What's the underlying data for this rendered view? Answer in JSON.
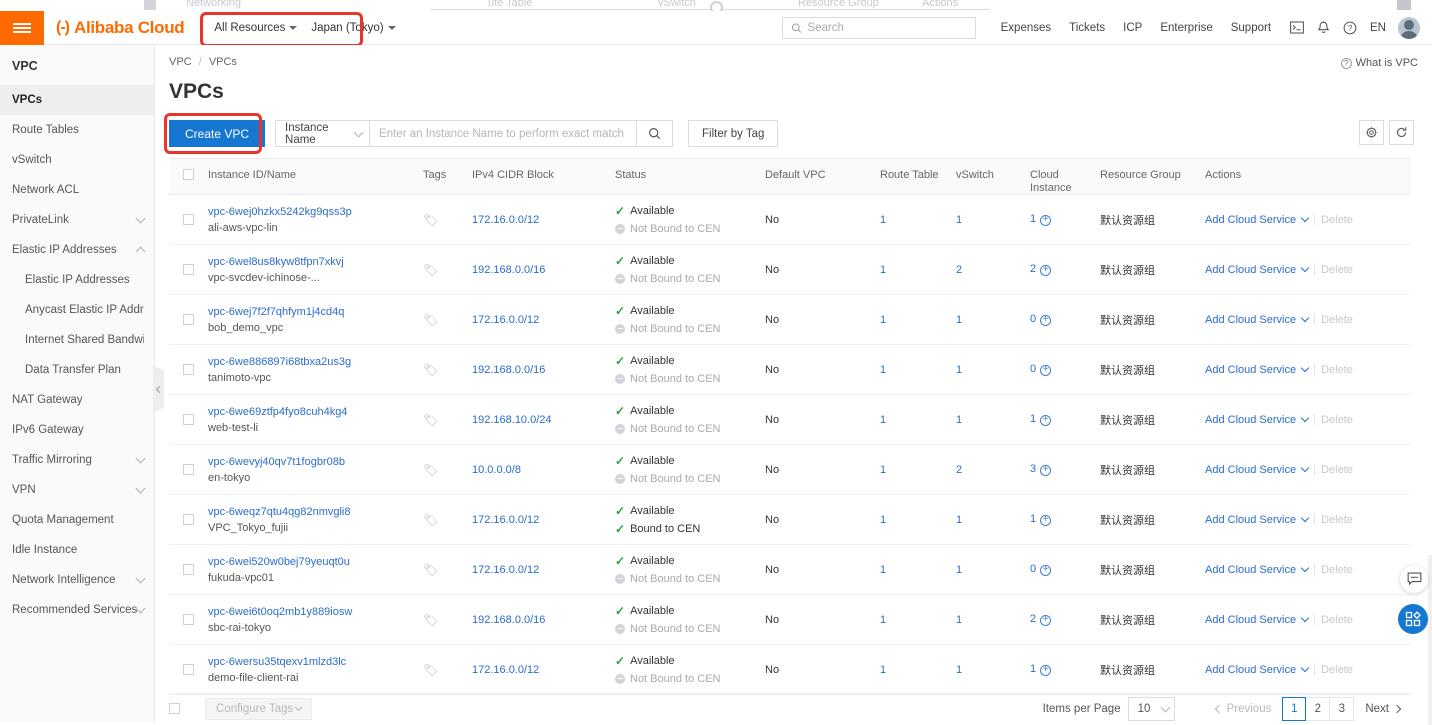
{
  "header": {
    "logo": "Alibaba Cloud",
    "logo_mark": "(-)",
    "resources_label": "All Resources",
    "region_label": "Japan (Tokyo)",
    "search_placeholder": "Search",
    "search_value": "",
    "links": [
      "Expenses",
      "Tickets",
      "ICP",
      "Enterprise",
      "Support"
    ],
    "icons": [
      "console-icon",
      "bell-icon",
      "help-icon"
    ],
    "language": "EN",
    "avatar": "user-avatar"
  },
  "sidebar": {
    "title": "VPC",
    "items": [
      {
        "label": "VPCs",
        "active": true,
        "expandable": false,
        "sub": false
      },
      {
        "label": "Route Tables",
        "active": false,
        "expandable": false,
        "sub": false
      },
      {
        "label": "vSwitch",
        "active": false,
        "expandable": false,
        "sub": false
      },
      {
        "label": "Network ACL",
        "active": false,
        "expandable": false,
        "sub": false
      },
      {
        "label": "PrivateLink",
        "active": false,
        "expandable": true,
        "expanded": false,
        "sub": false
      },
      {
        "label": "Elastic IP Addresses",
        "active": false,
        "expandable": true,
        "expanded": true,
        "sub": false
      },
      {
        "label": "Elastic IP Addresses",
        "active": false,
        "expandable": false,
        "sub": true
      },
      {
        "label": "Anycast Elastic IP Addresses",
        "active": false,
        "expandable": false,
        "sub": true
      },
      {
        "label": "Internet Shared Bandwidth",
        "active": false,
        "expandable": false,
        "sub": true
      },
      {
        "label": "Data Transfer Plan",
        "active": false,
        "expandable": false,
        "sub": true
      },
      {
        "label": "NAT Gateway",
        "active": false,
        "expandable": false,
        "sub": false
      },
      {
        "label": "IPv6 Gateway",
        "active": false,
        "expandable": false,
        "sub": false
      },
      {
        "label": "Traffic Mirroring",
        "active": false,
        "expandable": true,
        "expanded": false,
        "sub": false
      },
      {
        "label": "VPN",
        "active": false,
        "expandable": true,
        "expanded": false,
        "sub": false
      },
      {
        "label": "Quota Management",
        "active": false,
        "expandable": false,
        "sub": false
      },
      {
        "label": "Idle Instance",
        "active": false,
        "expandable": false,
        "sub": false
      },
      {
        "label": "Network Intelligence",
        "active": false,
        "expandable": true,
        "expanded": false,
        "sub": false
      },
      {
        "label": "Recommended Services",
        "active": false,
        "expandable": true,
        "expanded": false,
        "sub": false
      }
    ]
  },
  "main": {
    "breadcrumb": [
      "VPC",
      "VPCs"
    ],
    "breadcrumb_separator": "/",
    "what_is_link": "What is VPC",
    "page_title": "VPCs",
    "toolbar": {
      "create_button": "Create VPC",
      "filter_select": "Instance Name",
      "search_placeholder": "Enter an Instance Name to perform exact match",
      "search_value": "",
      "filter_by_tag": "Filter by Tag",
      "settings_icon": "gear-icon",
      "refresh_icon": "refresh-icon"
    },
    "table": {
      "columns": [
        "Instance ID/Name",
        "Tags",
        "IPv4 CIDR Block",
        "Status",
        "Default VPC",
        "Route Table",
        "vSwitch",
        "Cloud Instance",
        "Resource Group",
        "Actions"
      ],
      "cloud_instance_header_line1": "Cloud",
      "cloud_instance_header_line2": "Instance",
      "rows": [
        {
          "id": "vpc-6wej0hzkx5242kg9qss3p",
          "name": "ali-aws-vpc-lin",
          "cidr": "172.16.0.0/12",
          "status": "Available",
          "cen": "Not Bound to CEN",
          "cen_bound": false,
          "default_vpc": "No",
          "route_table": "1",
          "vswitch": "1",
          "cloud_instance": "1",
          "resource_group": "默认资源组",
          "action_primary": "Add Cloud Service",
          "action_secondary": "Delete"
        },
        {
          "id": "vpc-6wel8us8kyw8tfpn7xkvj",
          "name": "vpc-svcdev-ichinose-...",
          "cidr": "192.168.0.0/16",
          "status": "Available",
          "cen": "Not Bound to CEN",
          "cen_bound": false,
          "default_vpc": "No",
          "route_table": "1",
          "vswitch": "2",
          "cloud_instance": "2",
          "resource_group": "默认资源组",
          "action_primary": "Add Cloud Service",
          "action_secondary": "Delete"
        },
        {
          "id": "vpc-6wej7f2f7qhfym1j4cd4q",
          "name": "bob_demo_vpc",
          "cidr": "172.16.0.0/12",
          "status": "Available",
          "cen": "Not Bound to CEN",
          "cen_bound": false,
          "default_vpc": "No",
          "route_table": "1",
          "vswitch": "1",
          "cloud_instance": "0",
          "resource_group": "默认资源组",
          "action_primary": "Add Cloud Service",
          "action_secondary": "Delete"
        },
        {
          "id": "vpc-6we886897i68tbxa2us3g",
          "name": "tanimoto-vpc",
          "cidr": "192.168.0.0/16",
          "status": "Available",
          "cen": "Not Bound to CEN",
          "cen_bound": false,
          "default_vpc": "No",
          "route_table": "1",
          "vswitch": "1",
          "cloud_instance": "0",
          "resource_group": "默认资源组",
          "action_primary": "Add Cloud Service",
          "action_secondary": "Delete"
        },
        {
          "id": "vpc-6we69ztfp4fyo8cuh4kg4",
          "name": "web-test-li",
          "cidr": "192.168.10.0/24",
          "status": "Available",
          "cen": "Not Bound to CEN",
          "cen_bound": false,
          "default_vpc": "No",
          "route_table": "1",
          "vswitch": "1",
          "cloud_instance": "1",
          "resource_group": "默认资源组",
          "action_primary": "Add Cloud Service",
          "action_secondary": "Delete"
        },
        {
          "id": "vpc-6wevyj40qv7t1fogbr08b",
          "name": "en-tokyo",
          "cidr": "10.0.0.0/8",
          "status": "Available",
          "cen": "Not Bound to CEN",
          "cen_bound": false,
          "default_vpc": "No",
          "route_table": "1",
          "vswitch": "2",
          "cloud_instance": "3",
          "resource_group": "默认资源组",
          "action_primary": "Add Cloud Service",
          "action_secondary": "Delete"
        },
        {
          "id": "vpc-6weqz7qtu4qg82nmvgli8",
          "name": "VPC_Tokyo_fujii",
          "cidr": "172.16.0.0/12",
          "status": "Available",
          "cen": "Bound to CEN",
          "cen_bound": true,
          "default_vpc": "No",
          "route_table": "1",
          "vswitch": "1",
          "cloud_instance": "1",
          "resource_group": "默认资源组",
          "action_primary": "Add Cloud Service",
          "action_secondary": "Delete"
        },
        {
          "id": "vpc-6wei520w0bej79yeuqt0u",
          "name": "fukuda-vpc01",
          "cidr": "172.16.0.0/12",
          "status": "Available",
          "cen": "Not Bound to CEN",
          "cen_bound": false,
          "default_vpc": "No",
          "route_table": "1",
          "vswitch": "1",
          "cloud_instance": "0",
          "resource_group": "默认资源组",
          "action_primary": "Add Cloud Service",
          "action_secondary": "Delete"
        },
        {
          "id": "vpc-6wei6t0oq2mb1y889iosw",
          "name": "sbc-rai-tokyo",
          "cidr": "192.168.0.0/16",
          "status": "Available",
          "cen": "Not Bound to CEN",
          "cen_bound": false,
          "default_vpc": "No",
          "route_table": "1",
          "vswitch": "1",
          "cloud_instance": "2",
          "resource_group": "默认资源组",
          "action_primary": "Add Cloud Service",
          "action_secondary": "Delete"
        },
        {
          "id": "vpc-6wersu35tqexv1mlzd3lc",
          "name": "demo-file-client-rai",
          "cidr": "172.16.0.0/12",
          "status": "Available",
          "cen": "Not Bound to CEN",
          "cen_bound": false,
          "default_vpc": "No",
          "route_table": "1",
          "vswitch": "1",
          "cloud_instance": "1",
          "resource_group": "默认资源组",
          "action_primary": "Add Cloud Service",
          "action_secondary": "Delete"
        }
      ]
    },
    "footer": {
      "configure_tags": "Configure Tags",
      "items_per_page_label": "Items per Page",
      "items_per_page_value": "10",
      "previous": "Previous",
      "next": "Next",
      "pages": [
        "1",
        "2",
        "3"
      ],
      "current_page": "1"
    }
  },
  "widgets": {
    "chat_icon": "chat-bubble-icon",
    "apps_icon": "apps-grid-icon"
  },
  "colors": {
    "brand_orange": "#ff6a00",
    "primary_blue": "#1677d2",
    "link_blue": "#2b6ccb",
    "success_green": "#25a83a",
    "highlight_red": "#e8352a"
  }
}
